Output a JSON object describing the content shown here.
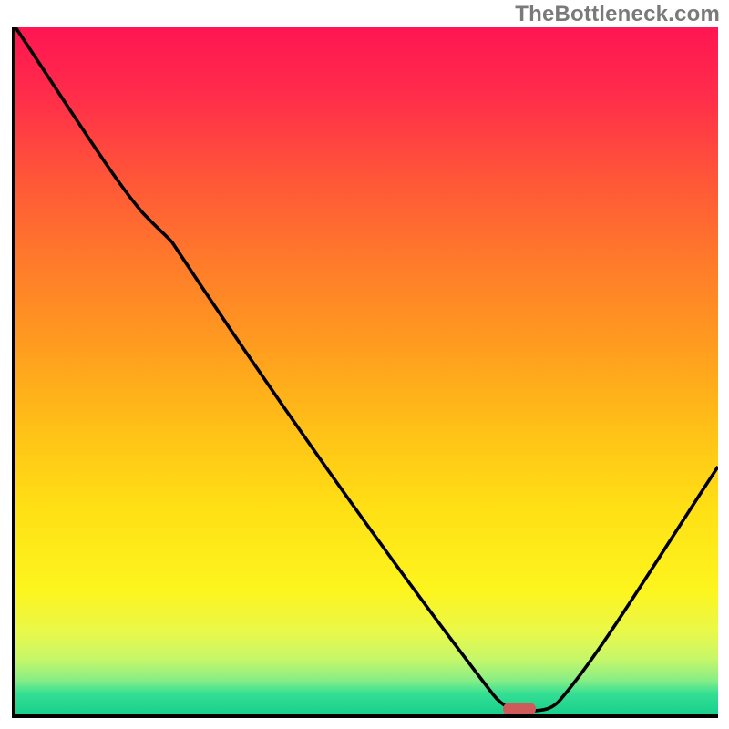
{
  "watermark": "TheBottleneck.com",
  "chart_data": {
    "type": "line",
    "title": "",
    "xlabel": "",
    "ylabel": "",
    "xlim": [
      0,
      100
    ],
    "ylim": [
      0,
      100
    ],
    "series": [
      {
        "name": "curve",
        "x": [
          0,
          18,
          22,
          68,
          73,
          76,
          100
        ],
        "y": [
          100,
          73,
          69,
          3,
          0.5,
          0.5,
          36
        ]
      }
    ],
    "marker": {
      "x": 74.5,
      "y": 0.5
    },
    "background_gradient_stops": [
      {
        "pos": 0,
        "color": "#ff1552"
      },
      {
        "pos": 10,
        "color": "#ff2d4a"
      },
      {
        "pos": 22,
        "color": "#ff5638"
      },
      {
        "pos": 34,
        "color": "#ff7a2b"
      },
      {
        "pos": 46,
        "color": "#ff9b1f"
      },
      {
        "pos": 58,
        "color": "#ffbf17"
      },
      {
        "pos": 70,
        "color": "#ffe015"
      },
      {
        "pos": 82,
        "color": "#fdf51e"
      },
      {
        "pos": 88,
        "color": "#e9f84a"
      },
      {
        "pos": 92,
        "color": "#c5f76a"
      },
      {
        "pos": 95,
        "color": "#88ee86"
      },
      {
        "pos": 97,
        "color": "#34df94"
      },
      {
        "pos": 100,
        "color": "#18cf8c"
      }
    ]
  }
}
